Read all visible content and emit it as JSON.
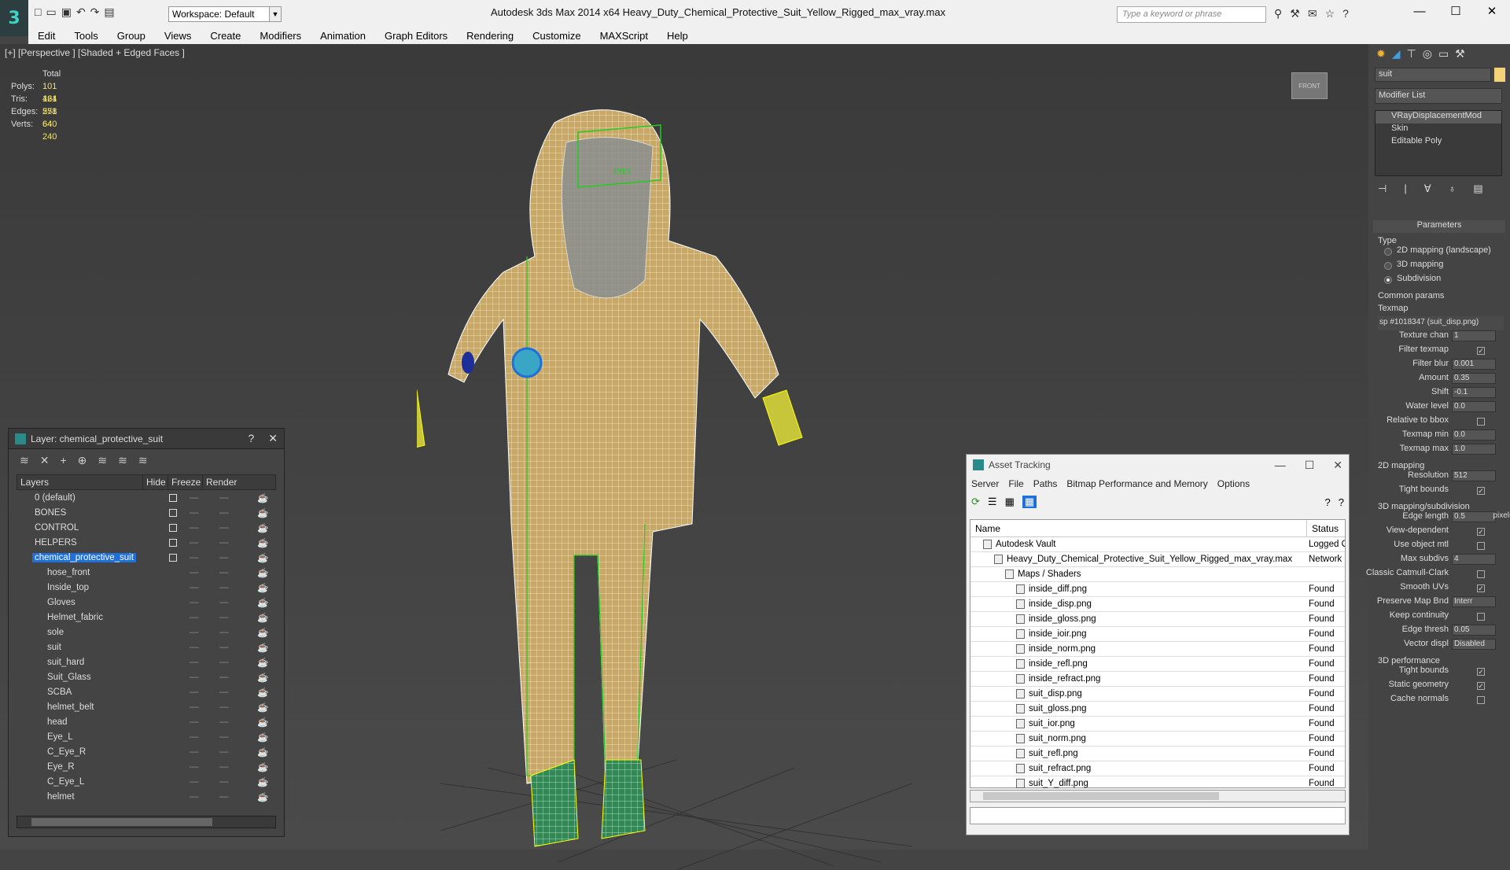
{
  "app": {
    "logo": "3",
    "workspace": "Workspace: Default",
    "window_title": "Autodesk 3ds Max  2014 x64      Heavy_Duty_Chemical_Protective_Suit_Yellow_Rigged_max_vray.max",
    "search_placeholder": "Type a keyword or phrase"
  },
  "menu": [
    "Edit",
    "Tools",
    "Group",
    "Views",
    "Create",
    "Modifiers",
    "Animation",
    "Graph Editors",
    "Rendering",
    "Customize",
    "MAXScript",
    "Help"
  ],
  "viewport": {
    "label": "[+] [Perspective ] [Shaded + Edged Faces ]",
    "stats": {
      "header": "Total",
      "rows": [
        {
          "label": "Polys:",
          "value": "101 464"
        },
        {
          "label": "Tris:",
          "value": "121 558"
        },
        {
          "label": "Edges:",
          "value": "271 640"
        },
        {
          "label": "Verts:",
          "value": "64 240"
        }
      ]
    },
    "viewcube_label": "FRONT"
  },
  "layers": {
    "title": "Layer: chemical_protective_suit",
    "help": "?",
    "close": "✕",
    "columns": [
      "Layers",
      "Hide",
      "Freeze",
      "Render"
    ],
    "rows": [
      {
        "name": "0 (default)",
        "level": 0,
        "sel": false
      },
      {
        "name": "BONES",
        "level": 0,
        "sel": false
      },
      {
        "name": "CONTROL",
        "level": 0,
        "sel": false
      },
      {
        "name": "HELPERS",
        "level": 0,
        "sel": false
      },
      {
        "name": "chemical_protective_suit",
        "level": 0,
        "sel": true
      },
      {
        "name": "hose_front",
        "level": 1,
        "sel": false
      },
      {
        "name": "Inside_top",
        "level": 1,
        "sel": false
      },
      {
        "name": "Gloves",
        "level": 1,
        "sel": false
      },
      {
        "name": "Helmet_fabric",
        "level": 1,
        "sel": false
      },
      {
        "name": "sole",
        "level": 1,
        "sel": false
      },
      {
        "name": "suit",
        "level": 1,
        "sel": false
      },
      {
        "name": "suit_hard",
        "level": 1,
        "sel": false
      },
      {
        "name": "Suit_Glass",
        "level": 1,
        "sel": false
      },
      {
        "name": "SCBA",
        "level": 1,
        "sel": false
      },
      {
        "name": "helmet_belt",
        "level": 1,
        "sel": false
      },
      {
        "name": "head",
        "level": 1,
        "sel": false
      },
      {
        "name": "Eye_L",
        "level": 1,
        "sel": false
      },
      {
        "name": "C_Eye_R",
        "level": 1,
        "sel": false
      },
      {
        "name": "Eye_R",
        "level": 1,
        "sel": false
      },
      {
        "name": "C_Eye_L",
        "level": 1,
        "sel": false
      },
      {
        "name": "helmet",
        "level": 1,
        "sel": false
      }
    ]
  },
  "asset_tracking": {
    "title": "Asset Tracking",
    "menu": [
      "Server",
      "File",
      "Paths",
      "Bitmap Performance and Memory",
      "Options"
    ],
    "columns": [
      "Name",
      "Status"
    ],
    "rows": [
      {
        "name": "Autodesk Vault",
        "status": "Logged Out",
        "indent": 0
      },
      {
        "name": "Heavy_Duty_Chemical_Protective_Suit_Yellow_Rigged_max_vray.max",
        "status": "Network",
        "indent": 1
      },
      {
        "name": "Maps / Shaders",
        "status": "",
        "indent": 2
      },
      {
        "name": "inside_diff.png",
        "status": "Found",
        "indent": 3
      },
      {
        "name": "inside_disp.png",
        "status": "Found",
        "indent": 3
      },
      {
        "name": "inside_gloss.png",
        "status": "Found",
        "indent": 3
      },
      {
        "name": "inside_ioir.png",
        "status": "Found",
        "indent": 3
      },
      {
        "name": "inside_norm.png",
        "status": "Found",
        "indent": 3
      },
      {
        "name": "inside_refl.png",
        "status": "Found",
        "indent": 3
      },
      {
        "name": "inside_refract.png",
        "status": "Found",
        "indent": 3
      },
      {
        "name": "suit_disp.png",
        "status": "Found",
        "indent": 3
      },
      {
        "name": "suit_gloss.png",
        "status": "Found",
        "indent": 3
      },
      {
        "name": "suit_ior.png",
        "status": "Found",
        "indent": 3
      },
      {
        "name": "suit_norm.png",
        "status": "Found",
        "indent": 3
      },
      {
        "name": "suit_refl.png",
        "status": "Found",
        "indent": 3
      },
      {
        "name": "suit_refract.png",
        "status": "Found",
        "indent": 3
      },
      {
        "name": "suit_Y_diff.png",
        "status": "Found",
        "indent": 3
      }
    ]
  },
  "command_panel": {
    "object_name": "suit",
    "modifier_list": "Modifier List",
    "stack": [
      "VRayDisplacementMod",
      "Skin",
      "Editable Poly"
    ],
    "params_title": "Parameters",
    "type_label": "Type",
    "type_options": [
      {
        "label": "2D mapping (landscape)",
        "on": false
      },
      {
        "label": "3D mapping",
        "on": false
      },
      {
        "label": "Subdivision",
        "on": true
      }
    ],
    "common_label": "Common params",
    "texmap_label": "Texmap",
    "texmap_value": "sp #1018347 (suit_disp.png)",
    "common_rows": [
      {
        "label": "Texture chan",
        "value": "1"
      },
      {
        "label": "Filter texmap",
        "check": true
      },
      {
        "label": "Filter blur",
        "value": "0.001"
      },
      {
        "label": "Amount",
        "value": "0.35"
      },
      {
        "label": "Shift",
        "value": "-0.1"
      },
      {
        "label": "Water level",
        "value": "0.0"
      },
      {
        "label": "Relative to bbox",
        "check": false
      },
      {
        "label": "Texmap min",
        "value": "0.0"
      },
      {
        "label": "Texmap max",
        "value": "1.0"
      }
    ],
    "map2d_label": "2D mapping",
    "map2d_rows": [
      {
        "label": "Resolution",
        "value": "512"
      },
      {
        "label": "Tight bounds",
        "check": true
      }
    ],
    "map3d_label": "3D mapping/subdivision",
    "map3d_rows": [
      {
        "label": "Edge length",
        "value": "0.5"
      },
      {
        "label": "View-dependent",
        "check": true
      },
      {
        "label": "Use object mtl",
        "check": false
      },
      {
        "label": "Max subdivs",
        "value": "4"
      },
      {
        "label": "Classic Catmull-Clark",
        "check": false
      },
      {
        "label": "Smooth UVs",
        "check": true
      },
      {
        "label": "Preserve Map Bnd",
        "value": "Interr"
      },
      {
        "label": "Keep continuity",
        "check": false
      },
      {
        "label": "Edge thresh",
        "value": "0.05"
      },
      {
        "label": "Vector displ",
        "value": "Disabled"
      }
    ],
    "pixels_label": "pixels",
    "perf_label": "3D performance",
    "perf_rows": [
      {
        "label": "Tight bounds",
        "check": true
      },
      {
        "label": "Static geometry",
        "check": true
      },
      {
        "label": "Cache normals",
        "check": false
      }
    ]
  }
}
